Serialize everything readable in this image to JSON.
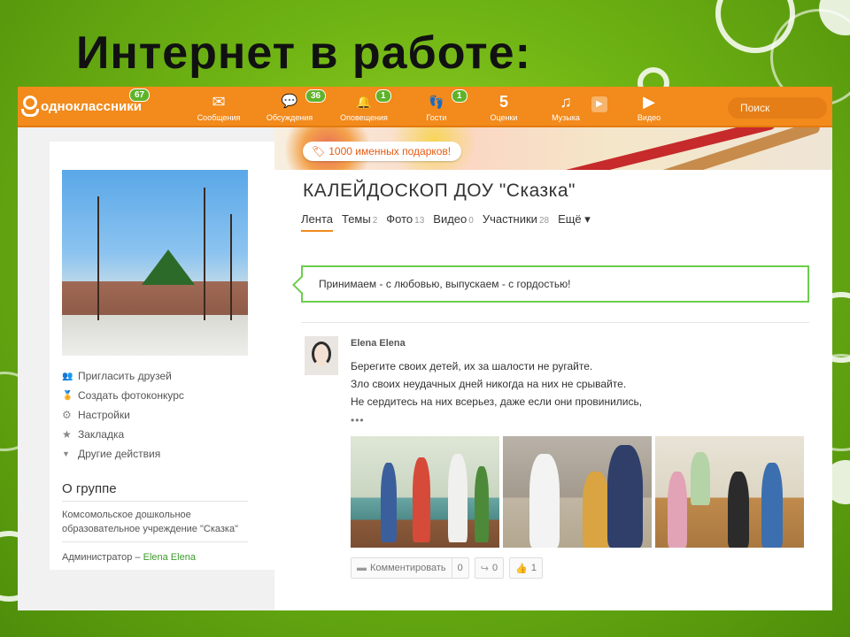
{
  "slide": {
    "title": "Интернет в работе:"
  },
  "topbar": {
    "site_name": "одноклассники",
    "site_badge": "67",
    "nav": [
      {
        "label": "Сообщения",
        "icon": "envelope-icon",
        "glyph": "✉",
        "badge": ""
      },
      {
        "label": "Обсуждения",
        "icon": "discussion-icon",
        "glyph": "💬",
        "badge": "36"
      },
      {
        "label": "Оповещения",
        "icon": "bell-icon",
        "glyph": "🔔",
        "badge": "1"
      },
      {
        "label": "Гости",
        "icon": "footprints-icon",
        "glyph": "👣",
        "badge": "1"
      },
      {
        "label": "Оценки",
        "icon": "ratings-icon",
        "glyph": "5",
        "badge": ""
      },
      {
        "label": "Музыка",
        "icon": "music-icon",
        "glyph": "♫",
        "badge": ""
      },
      {
        "label": "Видео",
        "icon": "video-camera-icon",
        "glyph": "▶",
        "badge": ""
      }
    ],
    "search_placeholder": "Поиск"
  },
  "banner": {
    "gift_text": "1000 именных подарков!"
  },
  "group": {
    "title": "КАЛЕЙДОСКОП  ДОУ \"Сказка\"",
    "tabs": [
      {
        "label": "Лента",
        "count": ""
      },
      {
        "label": "Темы",
        "count": "2"
      },
      {
        "label": "Фото",
        "count": "13"
      },
      {
        "label": "Видео",
        "count": "0"
      },
      {
        "label": "Участники",
        "count": "28"
      },
      {
        "label": "Ещё ▾",
        "count": ""
      }
    ],
    "motto": "Принимаем - с любовью, выпускаем - с гордостью!"
  },
  "sidebar": {
    "menu": [
      {
        "label": "Пригласить друзей",
        "icon": "people-icon",
        "glyph": "👥"
      },
      {
        "label": "Создать фотоконкурс",
        "icon": "medal-icon",
        "glyph": "🏅"
      },
      {
        "label": "Настройки",
        "icon": "gear-icon",
        "glyph": "⚙"
      },
      {
        "label": "Закладка",
        "icon": "star-icon",
        "glyph": "★"
      },
      {
        "label": "Другие действия",
        "icon": "triangle-down-icon",
        "glyph": "▼"
      }
    ],
    "about_title": "О группе",
    "about_text": "Комсомольское дошкольное образовательное учреждение \"Сказка\"",
    "admin_label": "Администратор –",
    "admin_name": "Elena Elena"
  },
  "post": {
    "author": "Elena Elena",
    "lines": [
      "Берегите своих детей, их за шалости не ругайте.",
      "Зло своих неудачных дней никогда на них не срывайте.",
      "Не сердитесь на них всерьез, даже если они провинились,"
    ],
    "more": "•••",
    "comment_label": "Комментировать",
    "comment_count": "0",
    "share_count": "0",
    "like_count": "1"
  }
}
